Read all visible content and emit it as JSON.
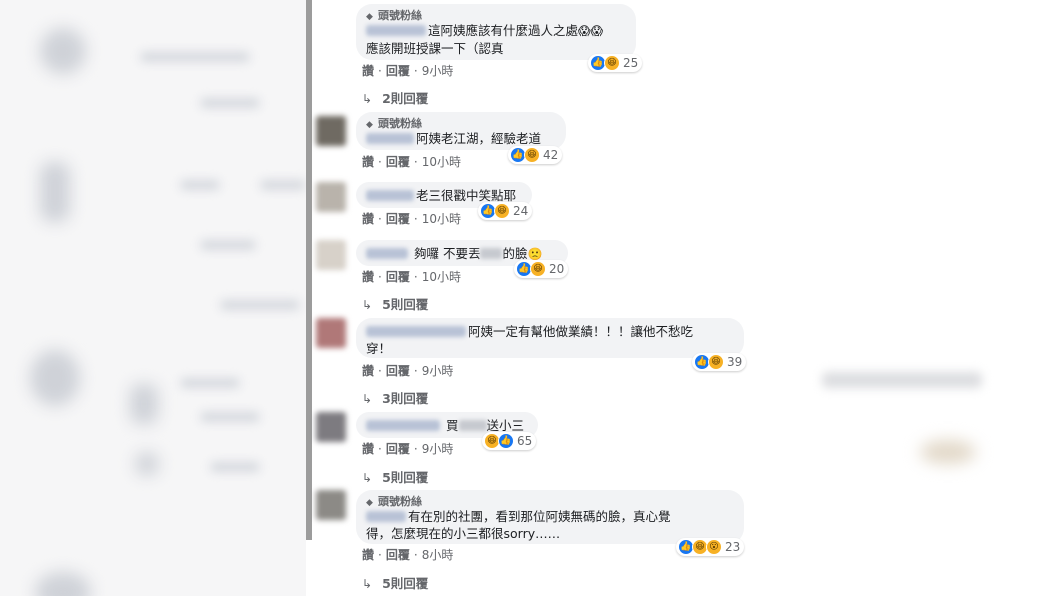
{
  "badge_label": "頭號粉絲",
  "like_label": "讚",
  "reply_label": "回覆",
  "comments": [
    {
      "line1": "這阿姨應該有什麼過人之處",
      "line1_emoji": "😱",
      "line2": "應該開班授課一下（認真",
      "time": "9小時",
      "reactions": "25",
      "replies": "2則回覆"
    },
    {
      "text": "阿姨老江湖，經驗老道",
      "time": "10小時",
      "reactions": "42"
    },
    {
      "text": "老三很戳中笑點耶",
      "time": "10小時",
      "reactions": "24"
    },
    {
      "text_a": "夠囉 不要丟",
      "text_b": "的臉",
      "text_emoji": "🙁",
      "time": "10小時",
      "reactions": "20",
      "replies": "5則回覆"
    },
    {
      "line1": "阿姨一定有幫他做業績！！！讓他不愁吃",
      "line2": "穿！",
      "time": "9小時",
      "reactions": "39",
      "replies": "3則回覆"
    },
    {
      "text_a": "買",
      "text_b": "送小三",
      "time": "9小時",
      "reactions": "65",
      "replies": "5則回覆"
    },
    {
      "line1": "有在別的社團，看到那位阿姨無碼的臉，真心覺",
      "line2": "得，怎麼現在的小三都很sorry……",
      "time": "8小時",
      "reactions": "23",
      "replies": "5則回覆"
    }
  ],
  "icons": {
    "badge": "diamond-badge-icon",
    "reply_arrow": "reply-arrow-icon",
    "like": "like-reaction-icon",
    "haha": "haha-reaction-icon",
    "wow": "wow-reaction-icon"
  },
  "colors": {
    "bubble": "#f2f3f5",
    "like_blue": "#1877f2",
    "muted_text": "#65676b"
  }
}
